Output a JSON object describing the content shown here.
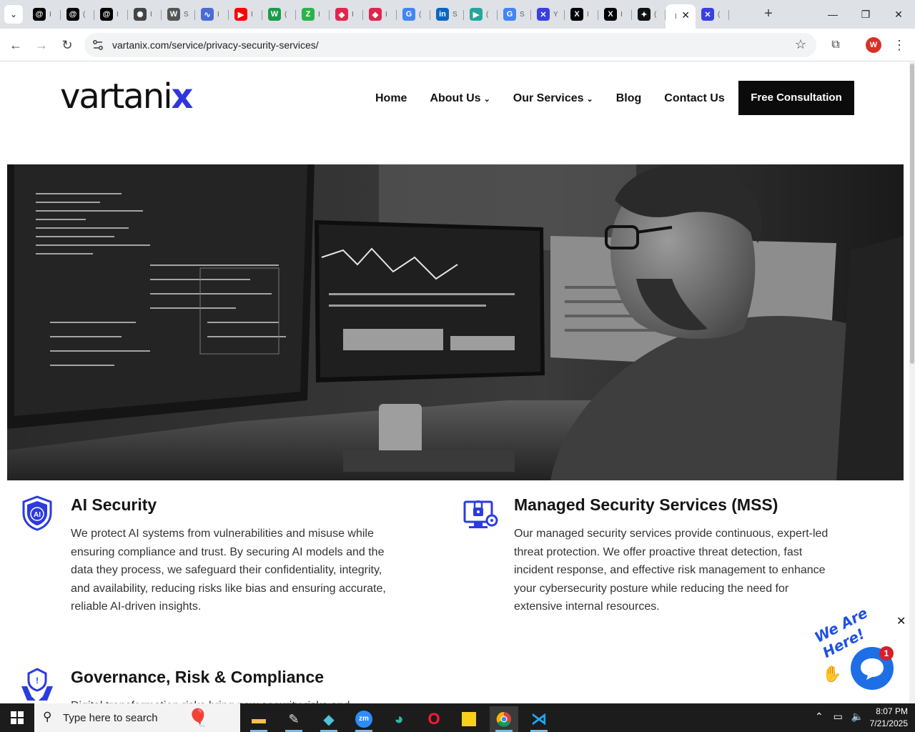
{
  "browser": {
    "tabs": [
      {
        "icon": "threads-icon",
        "color": "#000000",
        "glyph": "@",
        "label": "I"
      },
      {
        "icon": "threads-icon",
        "color": "#000000",
        "glyph": "@",
        "label": "("
      },
      {
        "icon": "threads-icon",
        "color": "#000000",
        "glyph": "@",
        "label": "I"
      },
      {
        "icon": "chatgpt-icon",
        "color": "#444444",
        "glyph": "✺",
        "label": "I"
      },
      {
        "icon": "wordpress-icon",
        "color": "#555555",
        "glyph": "W",
        "label": "S"
      },
      {
        "icon": "site-icon",
        "color": "#4a6cd4",
        "glyph": "∿",
        "label": "I"
      },
      {
        "icon": "youtube-icon",
        "color": "#ff0000",
        "glyph": "▶",
        "label": "I"
      },
      {
        "icon": "w-icon",
        "color": "#1a9b4a",
        "glyph": "W",
        "label": "("
      },
      {
        "icon": "z-icon",
        "color": "#2bb34a",
        "glyph": "Z",
        "label": "I"
      },
      {
        "icon": "tag-icon",
        "color": "#e0264f",
        "glyph": "◆",
        "label": "I"
      },
      {
        "icon": "tag-icon",
        "color": "#e0264f",
        "glyph": "◆",
        "label": "I"
      },
      {
        "icon": "google-icon",
        "color": "#4285f4",
        "glyph": "G",
        "label": "("
      },
      {
        "icon": "linkedin-icon",
        "color": "#0a66c2",
        "glyph": "in",
        "label": "S"
      },
      {
        "icon": "site-icon",
        "color": "#26a69a",
        "glyph": "▶",
        "label": "("
      },
      {
        "icon": "google-icon",
        "color": "#4285f4",
        "glyph": "G",
        "label": "S"
      },
      {
        "icon": "x-brand-icon",
        "color": "#3b3fe0",
        "glyph": "✕",
        "label": "Y"
      },
      {
        "icon": "x-icon",
        "color": "#000000",
        "glyph": "X",
        "label": "I"
      },
      {
        "icon": "x-icon",
        "color": "#000000",
        "glyph": "X",
        "label": "I"
      },
      {
        "icon": "sparkle-icon",
        "color": "#111111",
        "glyph": "✦",
        "label": "("
      }
    ],
    "active_tab": {
      "label": "I",
      "close": "✕"
    },
    "after_tabs": [
      {
        "icon": "x-brand-icon",
        "color": "#3b3fe0",
        "glyph": "✕",
        "label": "("
      }
    ],
    "new_tab": "+",
    "window_controls": {
      "minimize": "—",
      "maximize": "❐",
      "close": "✕"
    },
    "url": "vartanix.com/service/privacy-security-services/",
    "profile_initial": "W"
  },
  "site": {
    "logo_main": "vartani",
    "logo_accent": "x",
    "nav": [
      {
        "label": "Home",
        "caret": ""
      },
      {
        "label": "About Us",
        "caret": "⌄"
      },
      {
        "label": "Our Services",
        "caret": "⌄"
      },
      {
        "label": "Blog",
        "caret": ""
      },
      {
        "label": "Contact Us",
        "caret": ""
      }
    ],
    "cta": "Free Consultation"
  },
  "services": [
    {
      "title": "AI Security",
      "icon": "ai-shield-icon",
      "text": "We protect AI systems from vulnerabilities and misuse while ensuring compliance and trust. By securing AI models and the data they process, we safeguard their confidentiality, integrity, and availability, reducing risks like bias and ensuring accurate, reliable AI-driven insights."
    },
    {
      "title": "Managed Security Services (MSS)",
      "icon": "managed-security-icon",
      "text": "Our managed security services provide continuous, expert-led threat protection. We offer proactive threat detection, fast incident response, and effective risk management to enhance your cybersecurity posture while reducing the need for extensive internal resources."
    },
    {
      "title": "Governance, Risk & Compliance",
      "icon": "governance-icon",
      "text": "Digital transformation risks bring new security risks and"
    }
  ],
  "chat": {
    "tagline": "We Are Here!",
    "count": "1",
    "close": "✕"
  },
  "taskbar": {
    "search_placeholder": "Type here to search",
    "time": "8:07 PM",
    "date": "7/21/2025"
  },
  "colors": {
    "brand_accent": "#2f36e0",
    "icon_blue": "#2b3be0",
    "cta_bg": "#0b0b0b"
  }
}
